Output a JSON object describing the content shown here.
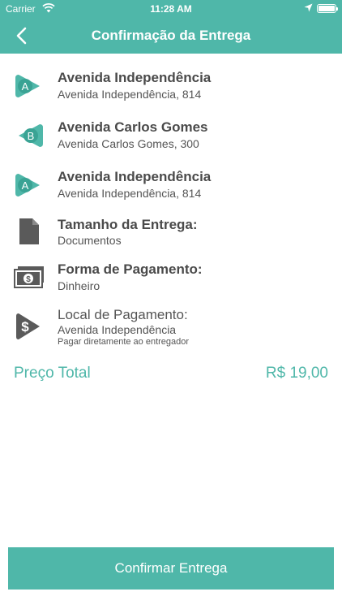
{
  "status": {
    "carrier": "Carrier",
    "time": "11:28 AM"
  },
  "nav": {
    "title": "Confirmação da Entrega"
  },
  "stops": [
    {
      "badge": "A",
      "title": "Avenida Independência",
      "address": "Avenida Independência, 814"
    },
    {
      "badge": "B",
      "title": "Avenida Carlos Gomes",
      "address": "Avenida Carlos Gomes, 300"
    },
    {
      "badge": "A",
      "title": "Avenida Independência",
      "address": "Avenida Independência, 814"
    }
  ],
  "size": {
    "label": "Tamanho da Entrega:",
    "value": "Documentos"
  },
  "payment": {
    "label": "Forma de Pagamento:",
    "value": "Dinheiro"
  },
  "payment_location": {
    "label": "Local de Pagamento:",
    "value": "Avenida Independência",
    "note": "Pagar diretamente ao entregador"
  },
  "total": {
    "label": "Preço Total",
    "value": "R$ 19,00"
  },
  "confirm_button": {
    "label": "Confirmar Entrega"
  },
  "colors": {
    "accent": "#4fb7a9",
    "icon_gray": "#5a5a5a"
  },
  "icons": {
    "wifi": "wifi-icon",
    "location": "location-arrow-icon",
    "battery": "battery-icon",
    "back": "chevron-left-icon",
    "stop": "map-pin-badge-icon",
    "document": "document-icon",
    "money": "banknote-icon",
    "dollar": "dollar-play-icon"
  }
}
